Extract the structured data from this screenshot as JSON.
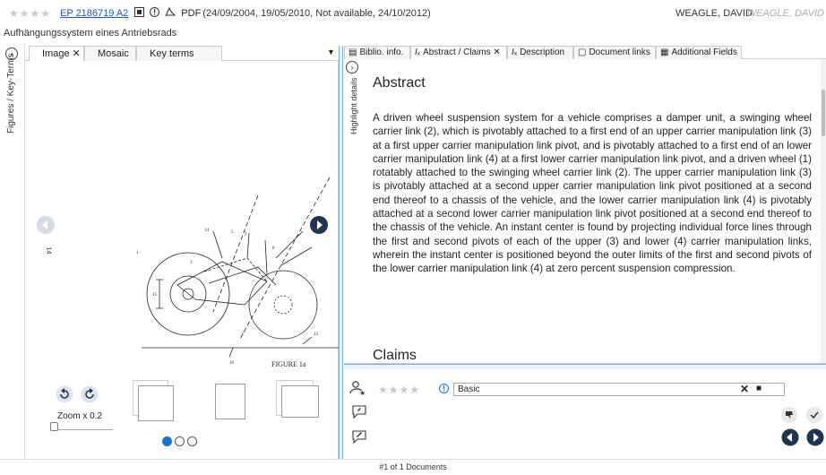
{
  "header": {
    "rating_stars": "★★★★",
    "patent_link": "EP 2186719 A2",
    "pdf_label": "PDF",
    "meta": "(24/09/2004, 19/05/2010, Not available, 24/10/2012)",
    "author": "WEAGLE, DAVID",
    "author_faded": "WEAGLE, DAVID",
    "subtitle": "Aufhängungssystem eines Antriebsrads"
  },
  "left_rail": {
    "label": "Figures / Key-Terms"
  },
  "left_tabs": [
    {
      "label": "Image",
      "close": "✕"
    },
    {
      "label": "Mosaic"
    },
    {
      "label": "Key terms"
    }
  ],
  "figure": {
    "caption": "FIGURE 1a",
    "page_number": "14",
    "zoom_label": "Zoom x 0.2"
  },
  "right_tabs": [
    {
      "label": "Biblio. info.",
      "icon": "biblio-icon"
    },
    {
      "label": "Abstract / Claims",
      "icon": "text-icon",
      "close": "✕"
    },
    {
      "label": "Description",
      "icon": "text-icon"
    },
    {
      "label": "Document links",
      "icon": "document-icon"
    },
    {
      "label": "Additional Fields",
      "icon": "fields-icon"
    }
  ],
  "highlight_label": "Highlight details",
  "abstract": {
    "title": "Abstract",
    "text": "A driven wheel suspension system for a vehicle comprises a damper unit, a swinging wheel carrier link (2), which is pivotably attached to a first end of an upper carrier manipulation link (3) at a first upper carrier manipulation link pivot, and is pivotably attached to a first end of an lower carrier manipulation link (4) at a first lower carrier manipulation link pivot, and a driven wheel (1) rotatably attached to the swinging wheel carrier link (2). The upper carrier manipulation link (3) is pivotably attached at a second upper carrier manipulation link pivot positioned at a second end thereof to a chassis of the vehicle, and the lower carrier manipulation link (4) is pivotably attached at a second lower carrier manipulation link pivot positioned at a second end thereof to the chassis of the vehicle. An instant center is found by projecting individual force lines through the first and second pivots of each of the upper (3) and lower (4) carrier manipulation links, wherein the instant center is positioned beyond the outer limits of the first and second pivots of the lower carrier manipulation link (4) at zero percent suspension compression."
  },
  "claims": {
    "title": "Claims"
  },
  "notes": {
    "stars": "★★★★",
    "category_value": "Basic",
    "close_label": "✕",
    "save_label": "■"
  },
  "footer": {
    "status": "#1 of 1 Documents"
  },
  "colors": {
    "accent": "#1a73d9",
    "link": "#1a56c4",
    "splitter": "#7aaee6"
  }
}
